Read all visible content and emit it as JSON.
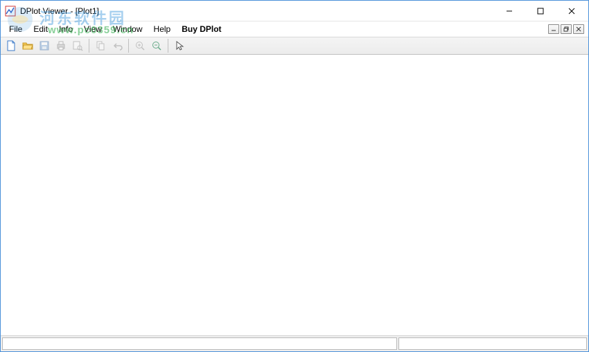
{
  "titlebar": {
    "title": "DPlot Viewer - [Plot1]"
  },
  "menu": {
    "file": "File",
    "edit": "Edit",
    "info": "Info",
    "view": "View",
    "window": "Window",
    "help": "Help",
    "buy": "Buy DPlot"
  },
  "toolbar_icons": {
    "new": "new-file-icon",
    "open": "open-folder-icon",
    "save": "save-icon",
    "print": "print-icon",
    "print_preview": "print-preview-icon",
    "copy": "copy-icon",
    "undo": "undo-icon",
    "zoom_in": "zoom-in-icon",
    "zoom_out": "zoom-out-icon",
    "cursor": "cursor-icon"
  },
  "statusbar": {
    "left": "",
    "right": ""
  },
  "watermark": {
    "cn_text": "河东软件园",
    "url_text": "www.pc0359.cn"
  }
}
